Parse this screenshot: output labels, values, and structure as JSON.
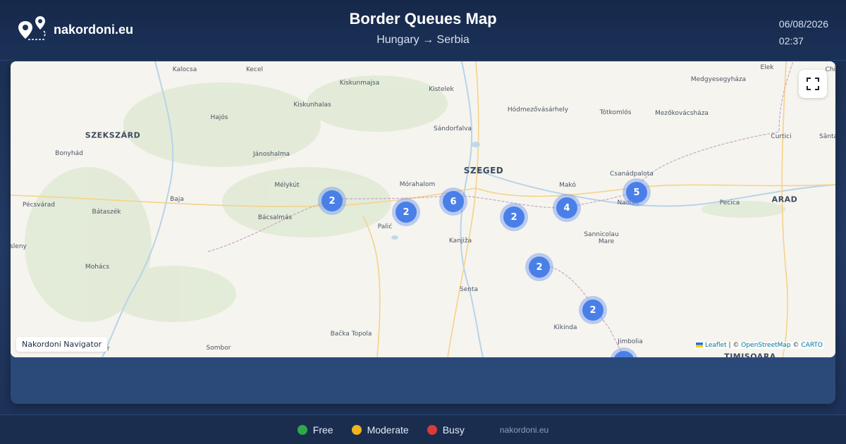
{
  "brand": {
    "name": "nakordoni.eu"
  },
  "header": {
    "title": "Border Queues Map",
    "route": "Hungary → Serbia"
  },
  "datetime": {
    "date": "06/08/2026",
    "time": "02:37"
  },
  "map": {
    "places": [
      {
        "name": "Kalocsa",
        "kind": "town"
      },
      {
        "name": "Kecel",
        "kind": "town"
      },
      {
        "name": "Kiskunmajsa",
        "kind": "town"
      },
      {
        "name": "Kistelek",
        "kind": "town"
      },
      {
        "name": "Elek",
        "kind": "town"
      },
      {
        "name": "Medgyesegyháza",
        "kind": "town"
      },
      {
        "name": "Kiskunhalas",
        "kind": "town"
      },
      {
        "name": "Hódmezővásárhely",
        "kind": "town"
      },
      {
        "name": "Tótkomlós",
        "kind": "town"
      },
      {
        "name": "Mezőkovácsháza",
        "kind": "town"
      },
      {
        "name": "Chisine",
        "kind": "town"
      },
      {
        "name": "Hajós",
        "kind": "town"
      },
      {
        "name": "Sándorfalva",
        "kind": "town"
      },
      {
        "name": "SZEKSZÁRD",
        "kind": "city"
      },
      {
        "name": "Curtici",
        "kind": "town"
      },
      {
        "name": "Sânta",
        "kind": "town"
      },
      {
        "name": "Bonyhád",
        "kind": "town"
      },
      {
        "name": "Jánoshalma",
        "kind": "town"
      },
      {
        "name": "SZEGED",
        "kind": "big"
      },
      {
        "name": "Csanádpalota",
        "kind": "town"
      },
      {
        "name": "Mélykút",
        "kind": "town"
      },
      {
        "name": "Mórahalom",
        "kind": "town"
      },
      {
        "name": "Makó",
        "kind": "town"
      },
      {
        "name": "Bátaszék",
        "kind": "town"
      },
      {
        "name": "Baja",
        "kind": "town"
      },
      {
        "name": "ARAD",
        "kind": "city"
      },
      {
        "name": "Pécsvárad",
        "kind": "town"
      },
      {
        "name": "Pecica",
        "kind": "town"
      },
      {
        "name": "Nadlac",
        "kind": "town"
      },
      {
        "name": "Bácsalmás",
        "kind": "town"
      },
      {
        "name": "Palić",
        "kind": "town"
      },
      {
        "name": "Sannicolau",
        "kind": "town"
      },
      {
        "name": "Mare",
        "kind": "town"
      },
      {
        "name": "Kanjiža",
        "kind": "town"
      },
      {
        "name": "Mohács",
        "kind": "town"
      },
      {
        "name": "Senta",
        "kind": "town"
      },
      {
        "name": "Kikinda",
        "kind": "town"
      },
      {
        "name": "Jimbolia",
        "kind": "town"
      },
      {
        "name": "Bačka Topola",
        "kind": "town"
      },
      {
        "name": "Sombor",
        "kind": "town"
      },
      {
        "name": "TIMISOARA",
        "kind": "city"
      },
      {
        "name": "sleny",
        "kind": "town"
      },
      {
        "name": "utir",
        "kind": "town"
      }
    ],
    "clusters": [
      2,
      2,
      6,
      2,
      4,
      5,
      2,
      2
    ],
    "navigator_label": "Nakordoni Navigator",
    "attribution": {
      "leaflet": "Leaflet",
      "sep1": " | © ",
      "osm": "OpenStreetMap",
      "sep2": " © ",
      "carto": "CARTO"
    },
    "fullscreen_icon": "fullscreen-icon"
  },
  "legend": [
    {
      "label": "Free",
      "color": "#2ea84a"
    },
    {
      "label": "Moderate",
      "color": "#f0b41c"
    },
    {
      "label": "Busy",
      "color": "#d93a3a"
    }
  ],
  "footer": {
    "site": "nakordoni.eu"
  },
  "colors": {
    "cluster": "#4a7fe8",
    "header_bg": "#16284a"
  }
}
